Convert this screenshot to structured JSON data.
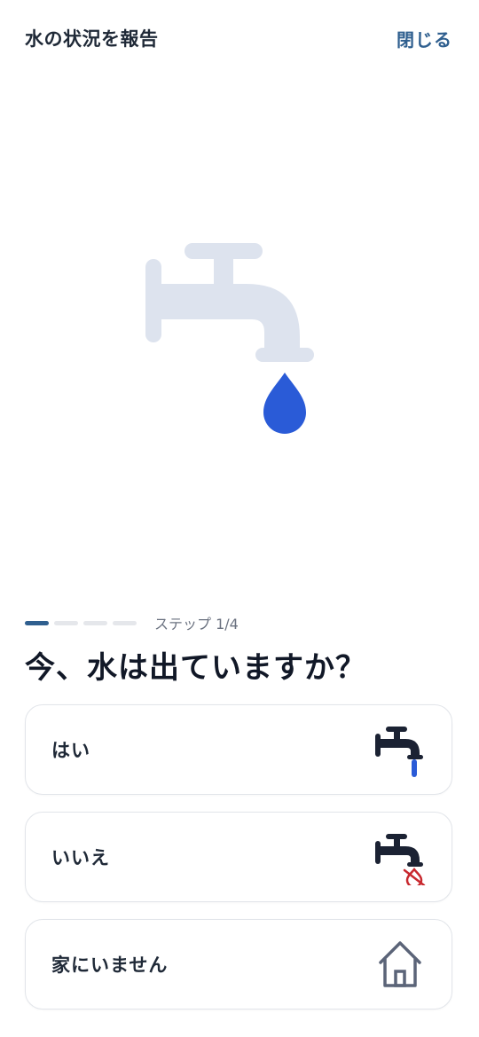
{
  "header": {
    "title": "水の状況を報告",
    "close_label": "閉じる"
  },
  "hero": {
    "icon": "faucet-with-water-drop-icon"
  },
  "progress": {
    "current_step": 1,
    "total_steps": 4,
    "label": "ステップ 1/4"
  },
  "question": "今、水は出ていますか？",
  "options": [
    {
      "label": "はい",
      "icon": "faucet-running-icon"
    },
    {
      "label": "いいえ",
      "icon": "faucet-no-water-icon"
    },
    {
      "label": "家にいません",
      "icon": "house-icon"
    }
  ],
  "colors": {
    "accent": "#2f5f8f",
    "drop": "#2a5bd7",
    "faucet_light": "#dde3ee",
    "faucet_dark": "#1b2233",
    "no_water_red": "#c8282e",
    "house_gray": "#5b6478"
  }
}
